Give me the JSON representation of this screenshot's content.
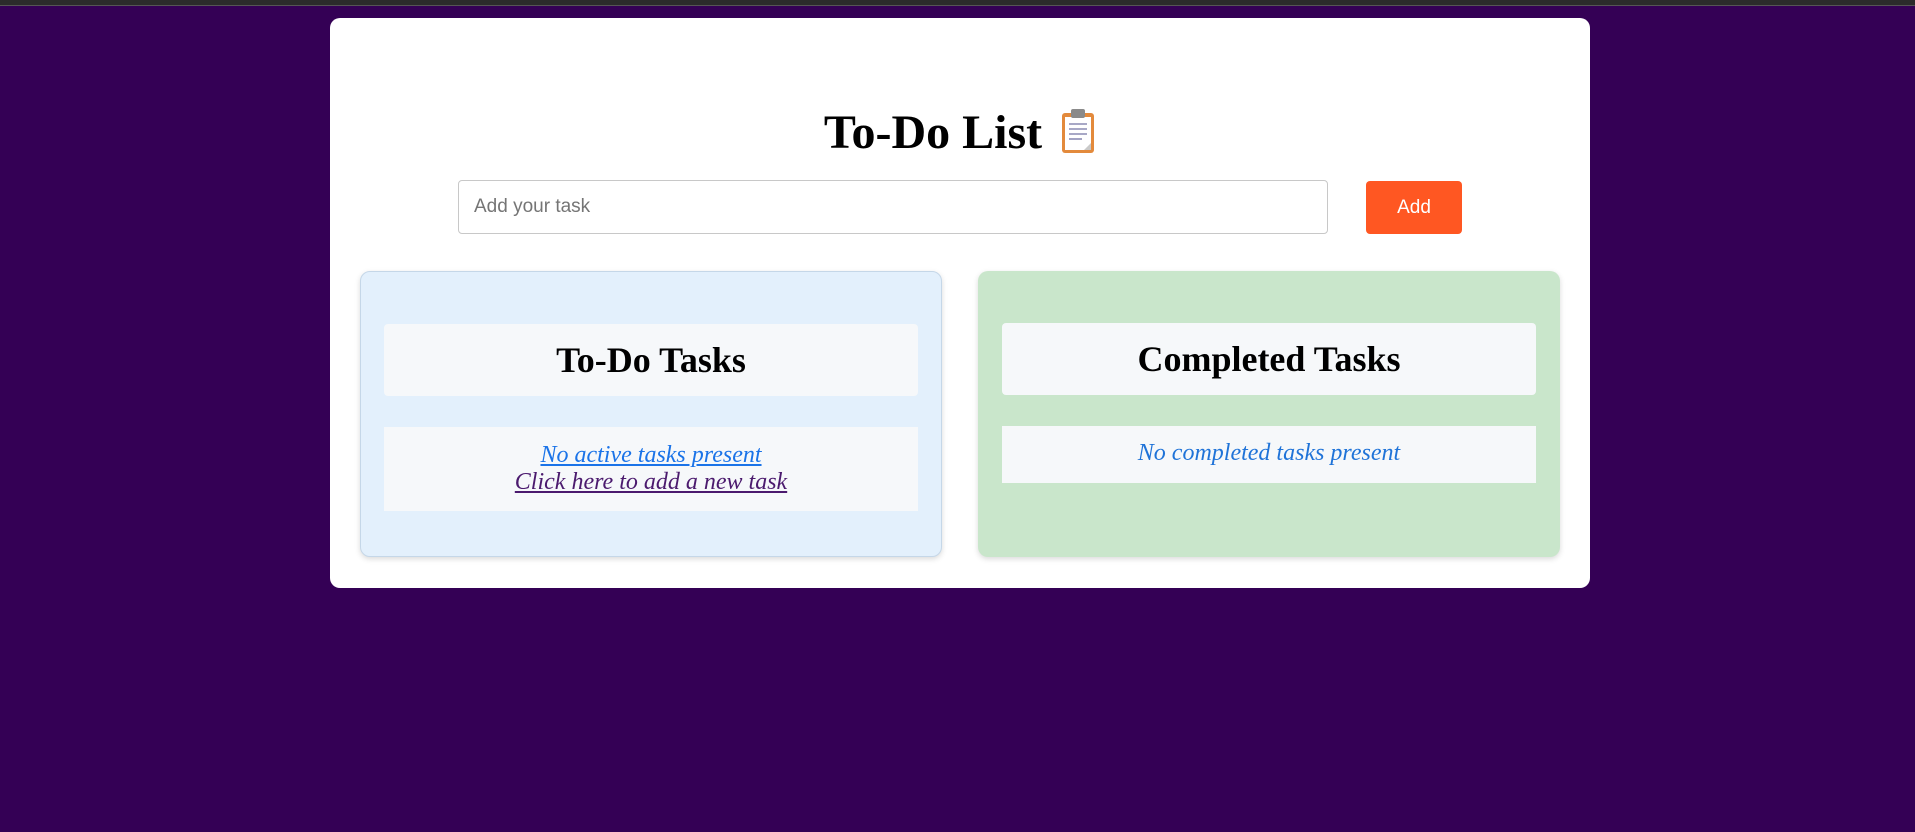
{
  "app": {
    "title": "To-Do List",
    "title_icon": "clipboard-icon"
  },
  "input": {
    "placeholder": "Add your task",
    "value": ""
  },
  "add_button": {
    "label": "Add"
  },
  "todo_panel": {
    "heading": "To-Do Tasks",
    "empty_message": "No active tasks present",
    "add_link": "Click here to add a new task"
  },
  "completed_panel": {
    "heading": "Completed Tasks",
    "empty_message": "No completed tasks present"
  },
  "colors": {
    "page_background": "#340055",
    "accent_button": "#ff5722",
    "todo_panel_bg": "#e3f0fc",
    "completed_panel_bg": "#c9e6cb",
    "link_blue": "#1a73e8"
  }
}
